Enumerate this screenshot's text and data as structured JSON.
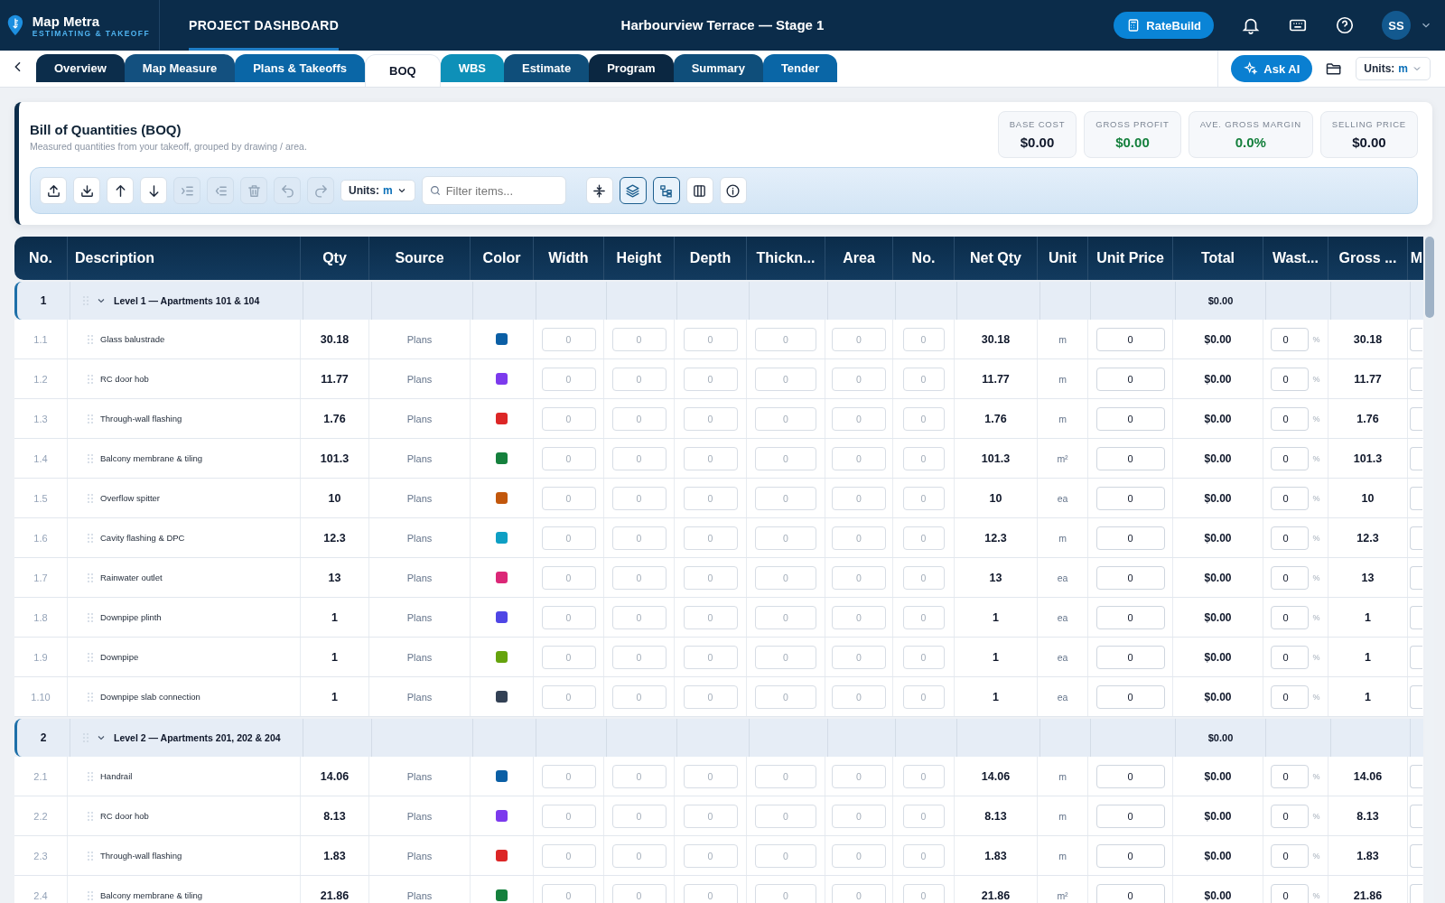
{
  "app": {
    "name": "Map Metra",
    "tagline": "ESTIMATING & TAKEOFF",
    "section": "PROJECT DASHBOARD",
    "project": "Harbourview Terrace — Stage 1",
    "ratebuild": "RateBuild",
    "avatar": "SS"
  },
  "tabs": [
    {
      "label": "Overview",
      "selected": false,
      "color": "#0c2d4b"
    },
    {
      "label": "Map Measure",
      "selected": false,
      "color": "#13507f"
    },
    {
      "label": "Plans & Takeoffs",
      "selected": false,
      "color": "#0a66a6"
    },
    {
      "label": "BOQ",
      "selected": true,
      "color": "#ffffff"
    },
    {
      "label": "WBS",
      "selected": false,
      "color": "#0e90b8"
    },
    {
      "label": "Estimate",
      "selected": false,
      "color": "#0f4e7a"
    },
    {
      "label": "Program",
      "selected": false,
      "color": "#0b2741"
    },
    {
      "label": "Summary",
      "selected": false,
      "color": "#0f4e7a"
    },
    {
      "label": "Tender",
      "selected": false,
      "color": "#0a66a6"
    }
  ],
  "ask_ai": "Ask AI",
  "units": {
    "label": "Units:",
    "value": "m"
  },
  "boq": {
    "title": "Bill of Quantities (BOQ)",
    "subtitle": "Measured quantities from your takeoff, grouped by drawing / area.",
    "stats": [
      {
        "label": "BASE COST",
        "value": "$0.00",
        "positive": false
      },
      {
        "label": "GROSS PROFIT",
        "value": "$0.00",
        "positive": true
      },
      {
        "label": "AVE. GROSS MARGIN",
        "value": "0.0%",
        "positive": true
      },
      {
        "label": "SELLING PRICE",
        "value": "$0.00",
        "positive": false
      }
    ]
  },
  "toolbar": {
    "left": [
      {
        "disabled": false
      },
      {
        "disabled": false
      },
      {
        "disabled": false
      },
      {
        "disabled": false
      },
      {
        "disabled": true
      },
      {
        "disabled": true
      },
      {
        "disabled": true
      },
      {
        "disabled": true
      },
      {
        "disabled": true
      }
    ],
    "units": {
      "label": "Units:",
      "value": "m"
    },
    "filter": {
      "placeholder": "Filter items..."
    },
    "right": [
      {
        "selected": false
      },
      {
        "selected": true
      },
      {
        "selected": true
      },
      {
        "selected": false
      },
      {
        "selected": false
      }
    ]
  },
  "table": {
    "columns": [
      "No.",
      "Description",
      "Qty",
      "Source",
      "Color",
      "Width",
      "Height",
      "Depth",
      "Thickn...",
      "Area",
      "No.",
      "Net Qty",
      "Unit",
      "Unit Price",
      "Total",
      "Wast...",
      "Gross ...",
      "M"
    ],
    "groups": [
      {
        "no": "1",
        "title": "Level 1 — Apartments 101 & 104",
        "total": "$0.00",
        "expanded": true,
        "rows": [
          {
            "no": "1.1",
            "description": "Glass balustrade",
            "qty": "30.18",
            "source": "Plans",
            "color": "#0b5fa5",
            "dims": [
              "0",
              "0",
              "0",
              "0",
              "0",
              "0"
            ],
            "net_qty": "30.18",
            "unit": "m",
            "unit_price": "0",
            "total": "$0.00",
            "waste": "0",
            "waste_unit": "%",
            "gross": "30.18"
          },
          {
            "no": "1.2",
            "description": "RC door hob",
            "qty": "11.77",
            "source": "Plans",
            "color": "#7c3aed",
            "dims": [
              "0",
              "0",
              "0",
              "0",
              "0",
              "0"
            ],
            "net_qty": "11.77",
            "unit": "m",
            "unit_price": "0",
            "total": "$0.00",
            "waste": "0",
            "waste_unit": "%",
            "gross": "11.77"
          },
          {
            "no": "1.3",
            "description": "Through-wall flashing",
            "qty": "1.76",
            "source": "Plans",
            "color": "#dc2626",
            "dims": [
              "0",
              "0",
              "0",
              "0",
              "0",
              "0"
            ],
            "net_qty": "1.76",
            "unit": "m",
            "unit_price": "0",
            "total": "$0.00",
            "waste": "0",
            "waste_unit": "%",
            "gross": "1.76"
          },
          {
            "no": "1.4",
            "description": "Balcony membrane & tiling",
            "qty": "101.3",
            "source": "Plans",
            "color": "#15803d",
            "dims": [
              "0",
              "0",
              "0",
              "0",
              "0",
              "0"
            ],
            "net_qty": "101.3",
            "unit": "m²",
            "unit_price": "0",
            "total": "$0.00",
            "waste": "0",
            "waste_unit": "%",
            "gross": "101.3"
          },
          {
            "no": "1.5",
            "description": "Overflow spitter",
            "qty": "10",
            "source": "Plans",
            "color": "#c2570c",
            "dims": [
              "0",
              "0",
              "0",
              "0",
              "0",
              "0"
            ],
            "net_qty": "10",
            "unit": "ea",
            "unit_price": "0",
            "total": "$0.00",
            "waste": "0",
            "waste_unit": "%",
            "gross": "10"
          },
          {
            "no": "1.6",
            "description": "Cavity flashing & DPC",
            "qty": "12.3",
            "source": "Plans",
            "color": "#0e9fc4",
            "dims": [
              "0",
              "0",
              "0",
              "0",
              "0",
              "0"
            ],
            "net_qty": "12.3",
            "unit": "m",
            "unit_price": "0",
            "total": "$0.00",
            "waste": "0",
            "waste_unit": "%",
            "gross": "12.3"
          },
          {
            "no": "1.7",
            "description": "Rainwater outlet",
            "qty": "13",
            "source": "Plans",
            "color": "#db2777",
            "dims": [
              "0",
              "0",
              "0",
              "0",
              "0",
              "0"
            ],
            "net_qty": "13",
            "unit": "ea",
            "unit_price": "0",
            "total": "$0.00",
            "waste": "0",
            "waste_unit": "%",
            "gross": "13"
          },
          {
            "no": "1.8",
            "description": "Downpipe plinth",
            "qty": "1",
            "source": "Plans",
            "color": "#4f46e5",
            "dims": [
              "0",
              "0",
              "0",
              "0",
              "0",
              "0"
            ],
            "net_qty": "1",
            "unit": "ea",
            "unit_price": "0",
            "total": "$0.00",
            "waste": "0",
            "waste_unit": "%",
            "gross": "1"
          },
          {
            "no": "1.9",
            "description": "Downpipe",
            "qty": "1",
            "source": "Plans",
            "color": "#65a30d",
            "dims": [
              "0",
              "0",
              "0",
              "0",
              "0",
              "0"
            ],
            "net_qty": "1",
            "unit": "ea",
            "unit_price": "0",
            "total": "$0.00",
            "waste": "0",
            "waste_unit": "%",
            "gross": "1"
          },
          {
            "no": "1.10",
            "description": "Downpipe slab connection",
            "qty": "1",
            "source": "Plans",
            "color": "#334155",
            "dims": [
              "0",
              "0",
              "0",
              "0",
              "0",
              "0"
            ],
            "net_qty": "1",
            "unit": "ea",
            "unit_price": "0",
            "total": "$0.00",
            "waste": "0",
            "waste_unit": "%",
            "gross": "1"
          }
        ]
      },
      {
        "no": "2",
        "title": "Level 2 — Apartments 201, 202 & 204",
        "total": "$0.00",
        "expanded": true,
        "rows": [
          {
            "no": "2.1",
            "description": "Handrail",
            "qty": "14.06",
            "source": "Plans",
            "color": "#0b5fa5",
            "dims": [
              "0",
              "0",
              "0",
              "0",
              "0",
              "0"
            ],
            "net_qty": "14.06",
            "unit": "m",
            "unit_price": "0",
            "total": "$0.00",
            "waste": "0",
            "waste_unit": "%",
            "gross": "14.06"
          },
          {
            "no": "2.2",
            "description": "RC door hob",
            "qty": "8.13",
            "source": "Plans",
            "color": "#7c3aed",
            "dims": [
              "0",
              "0",
              "0",
              "0",
              "0",
              "0"
            ],
            "net_qty": "8.13",
            "unit": "m",
            "unit_price": "0",
            "total": "$0.00",
            "waste": "0",
            "waste_unit": "%",
            "gross": "8.13"
          },
          {
            "no": "2.3",
            "description": "Through-wall flashing",
            "qty": "1.83",
            "source": "Plans",
            "color": "#dc2626",
            "dims": [
              "0",
              "0",
              "0",
              "0",
              "0",
              "0"
            ],
            "net_qty": "1.83",
            "unit": "m",
            "unit_price": "0",
            "total": "$0.00",
            "waste": "0",
            "waste_unit": "%",
            "gross": "1.83"
          },
          {
            "no": "2.4",
            "description": "Balcony membrane & tiling",
            "qty": "21.86",
            "source": "Plans",
            "color": "#15803d",
            "dims": [
              "0",
              "0",
              "0",
              "0",
              "0",
              "0"
            ],
            "net_qty": "21.86",
            "unit": "m²",
            "unit_price": "0",
            "total": "$0.00",
            "waste": "0",
            "waste_unit": "%",
            "gross": "21.86"
          }
        ]
      }
    ]
  }
}
